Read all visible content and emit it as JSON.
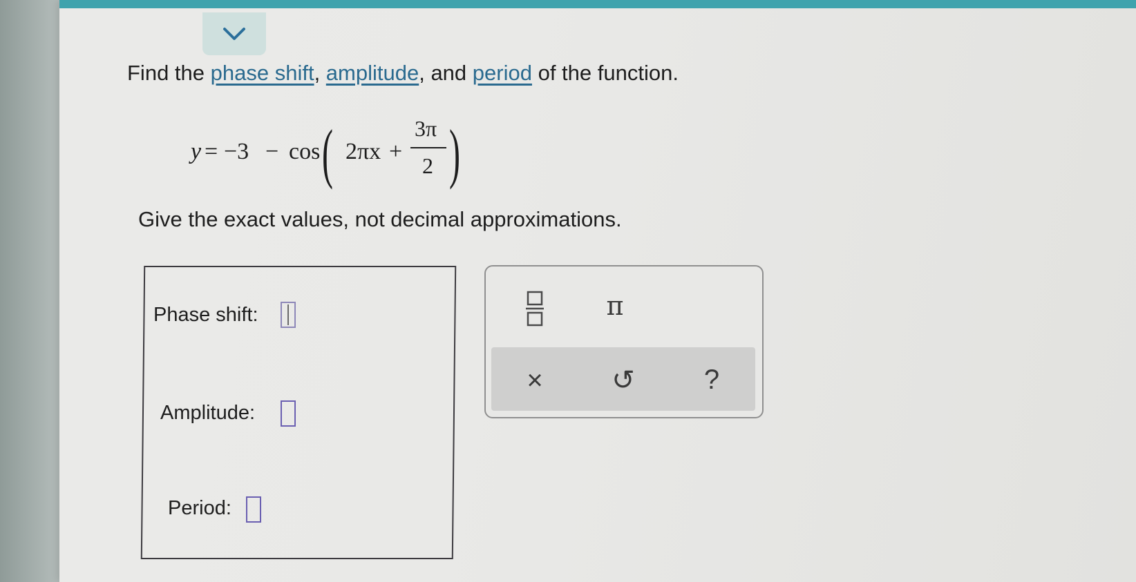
{
  "question": {
    "prefix": "Find the ",
    "link1": "phase shift",
    "sep1": ", ",
    "link2": "amplitude",
    "sep2": ", and ",
    "link3": "period",
    "suffix": " of the function."
  },
  "equation": {
    "lhs": "y",
    "eq": "=",
    "minus3": "−3",
    "minus": "−",
    "func": "cos",
    "arg": "2πx",
    "plus": "+",
    "num": "3π",
    "den": "2"
  },
  "instructions": "Give the exact values, not decimal approximations.",
  "answers": {
    "phase_shift_label": "Phase shift:",
    "amplitude_label": "Amplitude:",
    "period_label": "Period:"
  },
  "keypad": {
    "pi": "π",
    "clear": "×",
    "undo": "↺",
    "help": "?"
  },
  "colors": {
    "top_bar": "#3fa3ad",
    "link": "#2a6a8f",
    "input_border": "#6a5fb1"
  }
}
